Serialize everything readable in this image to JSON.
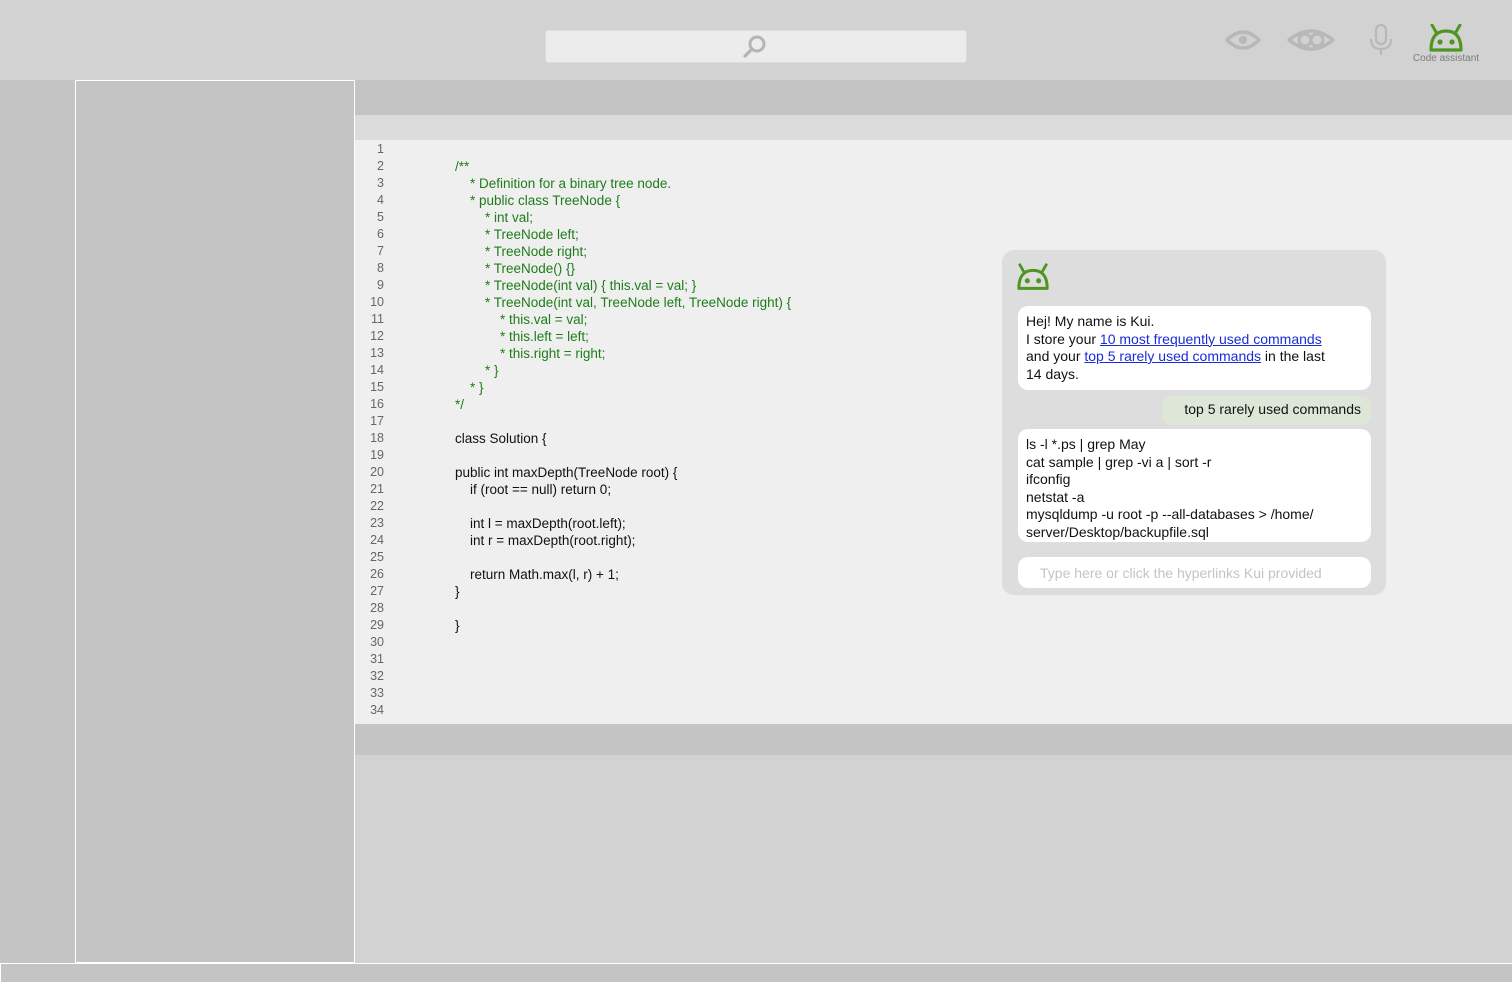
{
  "colors": {
    "accent": "#4e9620",
    "link": "#1a2bd8",
    "comment": "#1e7d19",
    "user_bubble": "#dee7d7"
  },
  "toolbar": {
    "search": {
      "value": "",
      "icon": "search-icon"
    },
    "icons": [
      "eye-icon",
      "eye-double-icon",
      "microphone-icon",
      "robot-icon"
    ],
    "assistant_label": "Code assistant"
  },
  "editor": {
    "lines": [
      {
        "n": "1",
        "text": "",
        "type": "code"
      },
      {
        "n": "2",
        "text": "/**",
        "type": "comment"
      },
      {
        "n": "3",
        "text": "    * Definition for a binary tree node.",
        "type": "comment"
      },
      {
        "n": "4",
        "text": "    * public class TreeNode {",
        "type": "comment"
      },
      {
        "n": "5",
        "text": "        * int val;",
        "type": "comment"
      },
      {
        "n": "6",
        "text": "        * TreeNode left;",
        "type": "comment"
      },
      {
        "n": "7",
        "text": "        * TreeNode right;",
        "type": "comment"
      },
      {
        "n": "8",
        "text": "        * TreeNode() {}",
        "type": "comment"
      },
      {
        "n": "9",
        "text": "        * TreeNode(int val) { this.val = val; }",
        "type": "comment"
      },
      {
        "n": "10",
        "text": "        * TreeNode(int val, TreeNode left, TreeNode right) {",
        "type": "comment"
      },
      {
        "n": "11",
        "text": "            * this.val = val;",
        "type": "comment"
      },
      {
        "n": "12",
        "text": "            * this.left = left;",
        "type": "comment"
      },
      {
        "n": "13",
        "text": "            * this.right = right;",
        "type": "comment"
      },
      {
        "n": "14",
        "text": "        * }",
        "type": "comment"
      },
      {
        "n": "15",
        "text": "    * }",
        "type": "comment"
      },
      {
        "n": "16",
        "text": "*/",
        "type": "comment"
      },
      {
        "n": "17",
        "text": "",
        "type": "code"
      },
      {
        "n": "18",
        "text": "class Solution {",
        "type": "code"
      },
      {
        "n": "19",
        "text": "",
        "type": "code"
      },
      {
        "n": "20",
        "text": "public int maxDepth(TreeNode root) {",
        "type": "code"
      },
      {
        "n": "21",
        "text": "    if (root == null) return 0;",
        "type": "code"
      },
      {
        "n": "22",
        "text": "",
        "type": "code"
      },
      {
        "n": "23",
        "text": "    int l = maxDepth(root.left);",
        "type": "code"
      },
      {
        "n": "24",
        "text": "    int r = maxDepth(root.right);",
        "type": "code"
      },
      {
        "n": "25",
        "text": "",
        "type": "code"
      },
      {
        "n": "26",
        "text": "    return Math.max(l, r) + 1;",
        "type": "code"
      },
      {
        "n": "27",
        "text": "}",
        "type": "code"
      },
      {
        "n": "28",
        "text": "",
        "type": "code"
      },
      {
        "n": "29",
        "text": "}",
        "type": "code"
      },
      {
        "n": "30",
        "text": "",
        "type": "code"
      },
      {
        "n": "31",
        "text": "",
        "type": "code"
      },
      {
        "n": "32",
        "text": "",
        "type": "code"
      },
      {
        "n": "33",
        "text": "",
        "type": "code"
      },
      {
        "n": "34",
        "text": "",
        "type": "code"
      }
    ]
  },
  "chat": {
    "avatar_icon": "robot-icon",
    "greeting": {
      "line1": "Hej! My name is Kui.",
      "line2_prefix": "I store your ",
      "link1": "10 most frequently used commands",
      "line3_prefix": "and your ",
      "link2": "top 5 rarely used commands",
      "line3_suffix": " in the last",
      "line4": "14 days."
    },
    "user_message": "top 5 rarely used commands",
    "reply_lines": [
      "ls -l *.ps | grep May",
      "cat sample | grep -vi a | sort -r",
      "ifconfig",
      "netstat -a",
      "mysqldump -u root -p --all-databases > /home/",
      "server/Desktop/backupfile.sql"
    ],
    "input_placeholder": "Type here or click the hyperlinks Kui provided"
  }
}
